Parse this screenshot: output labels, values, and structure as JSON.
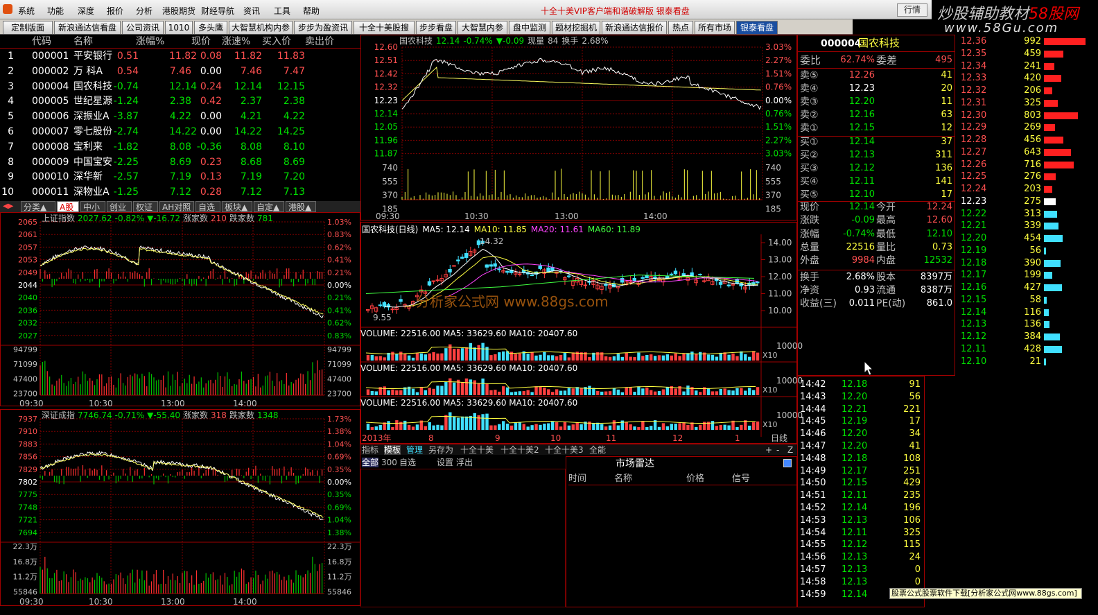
{
  "menu": {
    "items": [
      "系统",
      "功能",
      "深度",
      "报价",
      "分析",
      "港股期货",
      "财经导航",
      "资讯",
      "工具",
      "帮助"
    ],
    "center_title": "十全十美VIP客户端和谐破解版  银泰看盘",
    "right_button": "行情"
  },
  "logo": {
    "line1_a": "炒股辅助教材",
    "line1_b": "58股网",
    "line2": "www.58Gu.com"
  },
  "tabs": [
    "定制版面",
    "新浪通达信看盘",
    "公司资讯",
    "1010",
    "多头鹰",
    "大智慧机构内参",
    "步步为盈资讯",
    "十全十美股搜",
    "步步看盘",
    "大智慧内参",
    "盘中监测",
    "题材挖掘机",
    "新浪通达信报价",
    "热点",
    "所有市场",
    "银泰看盘"
  ],
  "quotes": {
    "headers": [
      "代码",
      "名称",
      "涨幅%",
      "现价",
      "涨速%",
      "买入价",
      "卖出价"
    ],
    "rows": [
      [
        "1",
        "000001",
        "平安银行",
        "0.51",
        "11.82",
        "0.08",
        "11.82",
        "11.83"
      ],
      [
        "2",
        "000002",
        "万  科A",
        "0.54",
        "7.46",
        "0.00",
        "7.46",
        "7.47"
      ],
      [
        "3",
        "000004",
        "国农科技",
        "-0.74",
        "12.14",
        "0.24",
        "12.14",
        "12.15"
      ],
      [
        "4",
        "000005",
        "世纪星源",
        "-1.24",
        "2.38",
        "0.42",
        "2.37",
        "2.38"
      ],
      [
        "5",
        "000006",
        "深振业A",
        "-3.87",
        "4.22",
        "0.00",
        "4.21",
        "4.22"
      ],
      [
        "6",
        "000007",
        "零七股份",
        "-2.74",
        "14.22",
        "0.00",
        "14.22",
        "14.25"
      ],
      [
        "7",
        "000008",
        "宝利来",
        "-1.82",
        "8.08",
        "-0.36",
        "8.08",
        "8.10"
      ],
      [
        "8",
        "000009",
        "中国宝安",
        "-2.25",
        "8.69",
        "0.23",
        "8.68",
        "8.69"
      ],
      [
        "9",
        "000010",
        "深华新",
        "-2.57",
        "7.19",
        "0.13",
        "7.19",
        "7.20"
      ],
      [
        "10",
        "000011",
        "深物业A",
        "-1.25",
        "7.12",
        "0.28",
        "7.12",
        "7.13"
      ]
    ]
  },
  "bottom_tabs": [
    "分类▲",
    "A股",
    "中小",
    "创业",
    "权证",
    "AH对照",
    "自选",
    "板块▲",
    "自定▲",
    "港股▲"
  ],
  "sh_index": {
    "name": "上证指数",
    "value": "2027.62",
    "pct": "-0.82%",
    "chg": "▼-16.72",
    "up_label": "涨家数",
    "up": "210",
    "down_label": "跌家数",
    "down": "781",
    "left_ticks": [
      "2065",
      "2061",
      "2057",
      "2053",
      "2049",
      "2044",
      "2040",
      "2036",
      "2032",
      "2027"
    ],
    "right_ticks": [
      "1.03%",
      "0.83%",
      "0.62%",
      "0.41%",
      "0.21%",
      "0.00%",
      "0.21%",
      "0.41%",
      "0.62%",
      "0.83%"
    ],
    "vol_ticks": [
      "94799",
      "71099",
      "47400",
      "23700"
    ],
    "times": [
      "09:30",
      "10:30",
      "13:00",
      "14:00"
    ]
  },
  "sz_index": {
    "name": "深证成指",
    "value": "7746.74",
    "pct": "-0.71%",
    "chg": "▼-55.40",
    "up_label": "涨家数",
    "up": "318",
    "down_label": "跌家数",
    "down": "1348",
    "left_ticks": [
      "7937",
      "7910",
      "7883",
      "7856",
      "7829",
      "7802",
      "7775",
      "7748",
      "7721",
      "7694"
    ],
    "right_ticks": [
      "1.73%",
      "1.38%",
      "1.04%",
      "0.69%",
      "0.35%",
      "0.00%",
      "0.35%",
      "0.69%",
      "1.04%",
      "1.38%"
    ],
    "vol_ticks": [
      "22.3万",
      "16.8万",
      "11.2万",
      "55846"
    ],
    "times": [
      "09:30",
      "10:30",
      "13:00",
      "14:00"
    ]
  },
  "intraday": {
    "title": "国农科技",
    "price": "12.14",
    "pct": "-0.74%",
    "chg": "▼-0.09",
    "vol_label": "现量",
    "vol": "84",
    "turn_label": "换手",
    "turn": "2.68%",
    "left_ticks": [
      "12.60",
      "12.51",
      "12.42",
      "12.32",
      "12.23",
      "12.14",
      "12.05",
      "11.96",
      "11.87"
    ],
    "right_ticks": [
      "3.03%",
      "2.27%",
      "1.51%",
      "0.76%",
      "0.00%",
      "0.76%",
      "1.51%",
      "2.27%",
      "3.03%"
    ],
    "vol_ticks": [
      "740",
      "555",
      "370",
      "185"
    ],
    "times": [
      "09:30",
      "10:30",
      "13:00",
      "14:00"
    ]
  },
  "kline": {
    "title": "国农科技(日线)",
    "ma5": "MA5: 12.14",
    "ma10": "MA10: 11.85",
    "ma20": "MA20: 11.61",
    "ma60": "MA60: 11.89",
    "ticks": [
      "14.00",
      "13.00",
      "12.00",
      "11.00",
      "10.00"
    ],
    "high_label": "14.32",
    "low_label": "9.55",
    "watermark": "分析家公式网 www.88gs.com"
  },
  "volpanels": [
    {
      "text": "VOLUME: 22516.00  MA5: 33629.60  MA10: 20407.60",
      "tick": "10000",
      "unit": "X10"
    },
    {
      "text": "VOLUME: 22516.00  MA5: 33629.60  MA10: 20407.60",
      "tick": "10000",
      "unit": "X10"
    },
    {
      "text": "VOLUME: 22516.00  MA5: 33629.60  MA10: 20407.60",
      "tick": "10000",
      "unit": "X10"
    }
  ],
  "date_axis": {
    "labels": [
      "2013年",
      "8",
      "9",
      "10",
      "11",
      "12",
      "1"
    ],
    "period": "日线"
  },
  "indicator_tabs": [
    "指标",
    "模板",
    "管理",
    "另存为",
    "十全十美",
    "十全十美2",
    "十全十美3",
    "全能"
  ],
  "radar": {
    "tabs": [
      "全部",
      "300",
      "自选",
      "设置",
      "浮出"
    ],
    "title": "市场雷达",
    "cols": [
      "时间",
      "名称",
      "价格",
      "信号"
    ]
  },
  "stock": {
    "code": "000004",
    "name": "国农科技",
    "wb_label": "委比",
    "wb": "62.74%",
    "wc_label": "委差",
    "wc": "495",
    "sell": [
      [
        "卖⑤",
        "12.26",
        "41"
      ],
      [
        "卖④",
        "12.23",
        "20"
      ],
      [
        "卖③",
        "12.20",
        "11"
      ],
      [
        "卖②",
        "12.16",
        "63"
      ],
      [
        "卖①",
        "12.15",
        "12"
      ]
    ],
    "buy": [
      [
        "买①",
        "12.14",
        "37"
      ],
      [
        "买②",
        "12.13",
        "311"
      ],
      [
        "买③",
        "12.12",
        "136"
      ],
      [
        "买④",
        "12.11",
        "141"
      ],
      [
        "买⑤",
        "12.10",
        "17"
      ]
    ],
    "stats": [
      [
        "现价",
        "12.14",
        "今开",
        "12.24"
      ],
      [
        "涨跌",
        "-0.09",
        "最高",
        "12.60"
      ],
      [
        "涨幅",
        "-0.74%",
        "最低",
        "12.10"
      ],
      [
        "总量",
        "22516",
        "量比",
        "0.73"
      ],
      [
        "外盘",
        "9984",
        "内盘",
        "12532"
      ],
      [
        "换手",
        "2.68%",
        "股本",
        "8397万"
      ],
      [
        "净资",
        "0.93",
        "流通",
        "8387万"
      ],
      [
        "收益(三)",
        "0.011",
        "PE(动)",
        "861.0"
      ]
    ]
  },
  "depth": [
    [
      "12.36",
      "992"
    ],
    [
      "12.35",
      "459"
    ],
    [
      "12.34",
      "241"
    ],
    [
      "12.33",
      "420"
    ],
    [
      "12.32",
      "206"
    ],
    [
      "12.31",
      "325"
    ],
    [
      "12.30",
      "803"
    ],
    [
      "12.29",
      "269"
    ],
    [
      "12.28",
      "456"
    ],
    [
      "12.27",
      "643"
    ],
    [
      "12.26",
      "716"
    ],
    [
      "12.25",
      "276"
    ],
    [
      "12.24",
      "203"
    ],
    [
      "12.23",
      "275"
    ],
    [
      "12.22",
      "313"
    ],
    [
      "12.21",
      "339"
    ],
    [
      "12.20",
      "454"
    ],
    [
      "12.19",
      "56"
    ],
    [
      "12.18",
      "390"
    ],
    [
      "12.17",
      "199"
    ],
    [
      "12.16",
      "427"
    ],
    [
      "12.15",
      "58"
    ],
    [
      "12.14",
      "116"
    ],
    [
      "12.13",
      "136"
    ],
    [
      "12.12",
      "384"
    ],
    [
      "12.11",
      "428"
    ],
    [
      "12.10",
      "21"
    ]
  ],
  "ticks_list": [
    [
      "14:42",
      "12.18",
      "91"
    ],
    [
      "14:43",
      "12.20",
      "56"
    ],
    [
      "14:44",
      "12.21",
      "221"
    ],
    [
      "14:45",
      "12.19",
      "17"
    ],
    [
      "14:46",
      "12.20",
      "34"
    ],
    [
      "14:47",
      "12.20",
      "41"
    ],
    [
      "14:48",
      "12.18",
      "108"
    ],
    [
      "14:49",
      "12.17",
      "251"
    ],
    [
      "14:50",
      "12.15",
      "429"
    ],
    [
      "14:51",
      "12.11",
      "235"
    ],
    [
      "14:52",
      "12.14",
      "196"
    ],
    [
      "14:53",
      "12.13",
      "106"
    ],
    [
      "14:54",
      "12.11",
      "325"
    ],
    [
      "14:55",
      "12.12",
      "115"
    ],
    [
      "14:56",
      "12.13",
      "24"
    ],
    [
      "14:57",
      "12.13",
      "0"
    ],
    [
      "14:58",
      "12.13",
      "0"
    ],
    [
      "14:59",
      "12.14",
      "0"
    ]
  ],
  "footer_ad": "股票公式股票软件下载[分析家公式网www.88gs.com]"
}
